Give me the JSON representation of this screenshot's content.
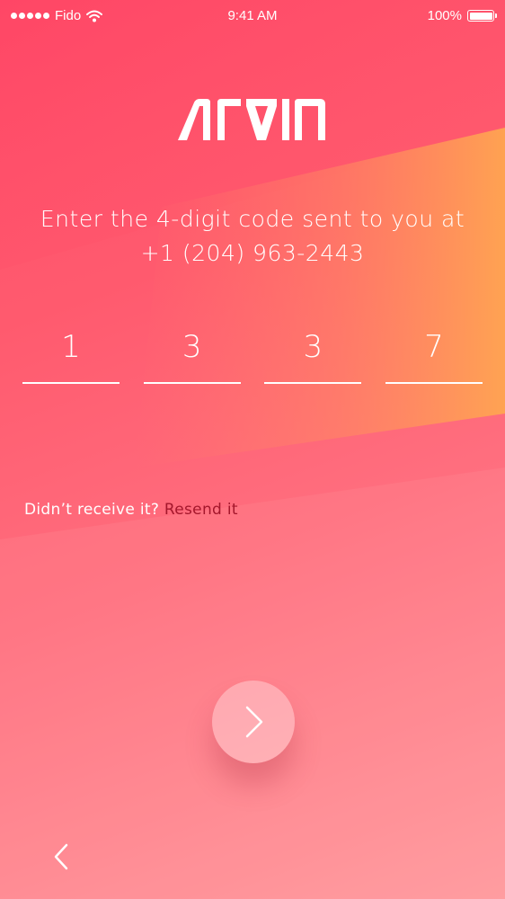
{
  "status_bar": {
    "carrier": "Fido",
    "time": "9:41 AM",
    "battery": "100%"
  },
  "brand": {
    "logo_text": "ARVIN"
  },
  "verification": {
    "prompt_line1": "Enter the 4-digit code sent to you at",
    "prompt_line2": "+1 (204) 963-2443",
    "code_digits": [
      "1",
      "3",
      "3",
      "7"
    ]
  },
  "resend": {
    "question": "Didn’t receive it?",
    "link": "Resend it"
  },
  "icons": {
    "next": "chevron-right-icon",
    "back": "chevron-left-icon",
    "wifi": "wifi-icon",
    "battery": "battery-icon"
  },
  "colors": {
    "background_primary": "#ff5a6e",
    "background_accent": "#ffa150",
    "link": "#a4172c",
    "text": "#ffffff"
  }
}
